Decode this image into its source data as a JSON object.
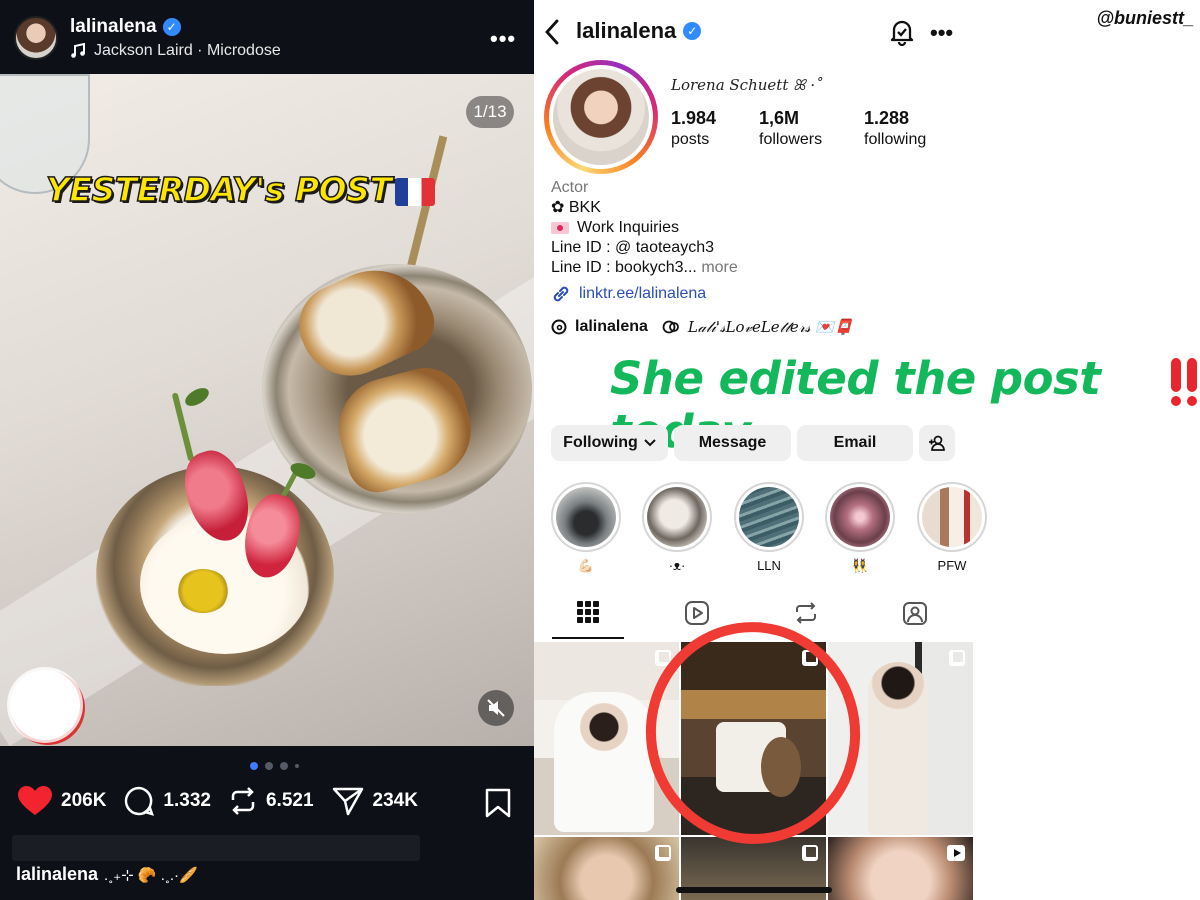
{
  "watermark": "@buniestt_",
  "post": {
    "username": "lalinalena",
    "music": "Jackson Laird · Microdose",
    "counter": "1/13",
    "overlay_text": "YESTERDAY's POST",
    "likes": "206K",
    "comments": "1.332",
    "reposts": "6.521",
    "shares": "234K",
    "caption_user": "lalinalena",
    "caption_deco": ".˳₊⊹ 🥐 .˳.·🥖"
  },
  "profile": {
    "username": "lalinalena",
    "full_name": "Lorena Schuett ꕤ ·˚",
    "stats": {
      "posts_num": "1.984",
      "posts_lbl": "posts",
      "followers_num": "1,6M",
      "followers_lbl": "followers",
      "following_num": "1.288",
      "following_lbl": "following"
    },
    "bio": {
      "category": "Actor",
      "line1": "✿ BKK",
      "line2": "Work Inquiries",
      "line3": "Line ID : @ taoteaych3",
      "line4": "Line ID : bookych3...",
      "more": "more"
    },
    "link": "linktr.ee/lalinalena",
    "threads_handle": "lalinalena",
    "channel_name": "𝐿𝒶𝓁𝒾'𝓈𝐿𝑜𝓋𝑒𝐿𝑒𝓉𝓉𝑒𝓇𝓈 💌📮",
    "note": "She edited the post today",
    "buttons": {
      "following": "Following",
      "message": "Message",
      "email": "Email"
    },
    "highlights": [
      {
        "label": "💪🏻",
        "color": "#6b6f72"
      },
      {
        "label": "·ᴥ·",
        "color": "#b9b2aa"
      },
      {
        "label": "LLN",
        "color": "#5f7f86"
      },
      {
        "label": "👯‍♀️",
        "color": "#9a6e78"
      },
      {
        "label": "PFW",
        "color": "#a8816b"
      }
    ]
  },
  "colors": {
    "accent_blue": "#3d7cff",
    "note_green": "#13b85a",
    "overlay_yellow": "#ffe600",
    "circle_red": "#ef3b33"
  }
}
